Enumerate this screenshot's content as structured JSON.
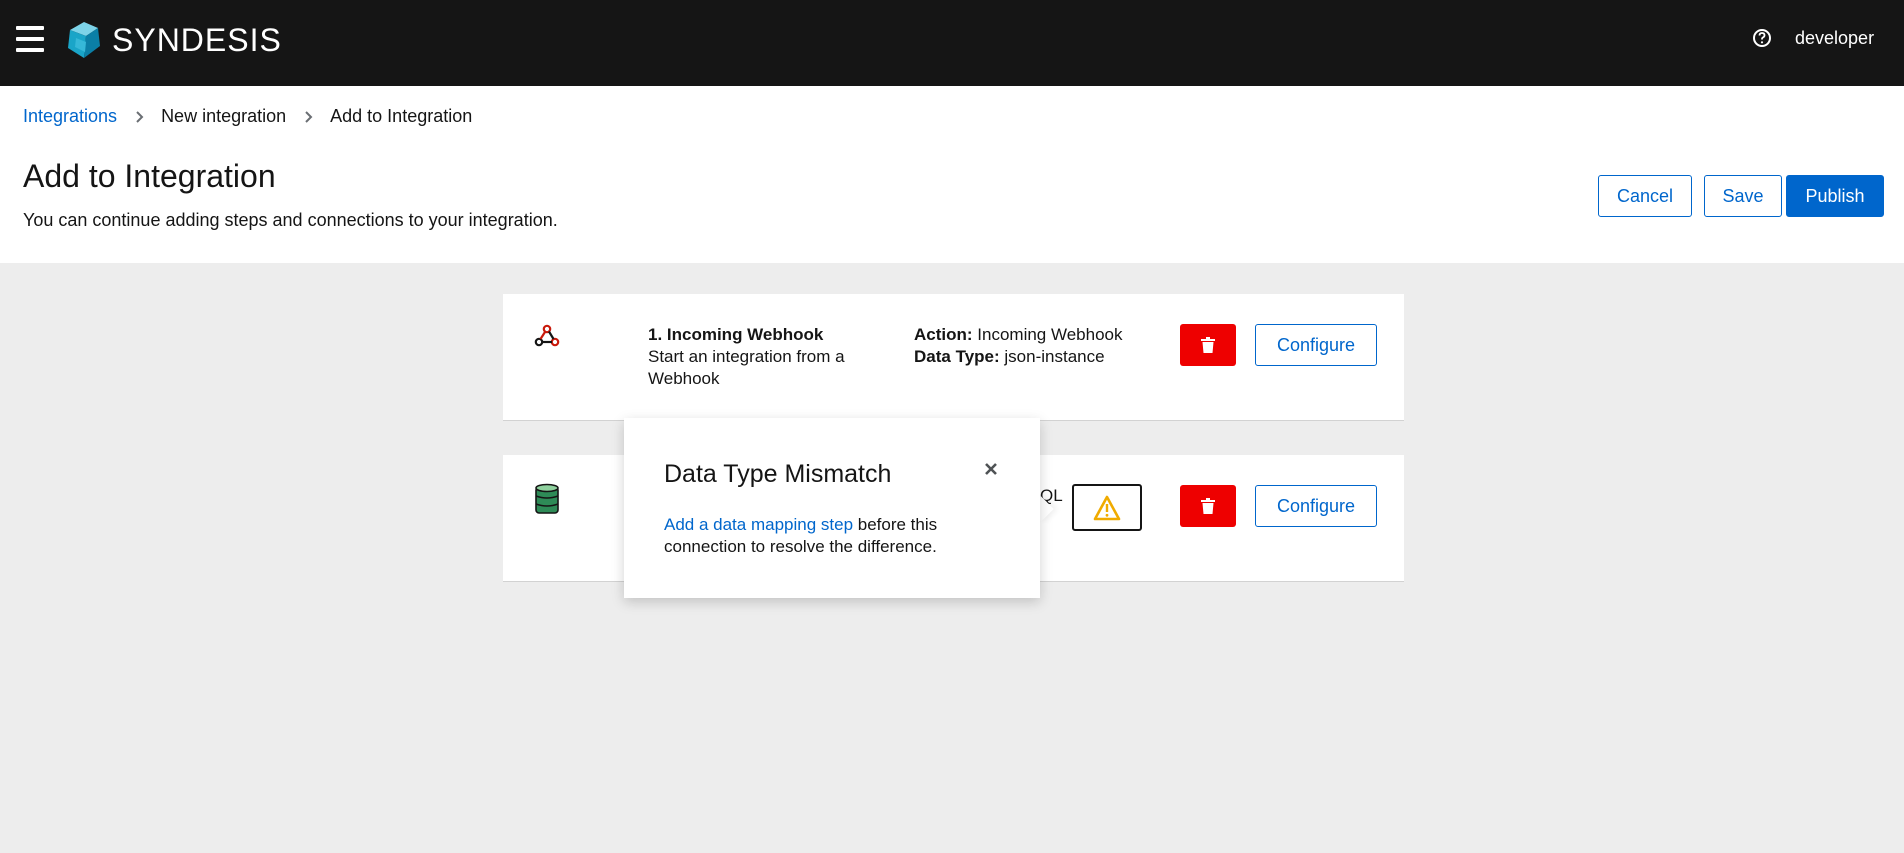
{
  "masthead": {
    "brand": "SYNDESIS",
    "username": "developer",
    "menu_icon": "hamburger-menu-icon",
    "help_icon": "help-circle-icon"
  },
  "breadcrumb": {
    "items": [
      "Integrations",
      "New integration",
      "Add to Integration"
    ]
  },
  "header": {
    "title": "Add to Integration",
    "description": "You can continue adding steps and connections to your integration."
  },
  "actions": {
    "cancel": "Cancel",
    "save": "Save",
    "publish": "Publish"
  },
  "steps": [
    {
      "icon": "webhook-icon",
      "title": "1. Incoming Webhook",
      "subtitle": "Start an integration from a Webhook",
      "action_label": "Action:",
      "action_value": "Incoming Webhook",
      "datatype_label": "Data Type:",
      "datatype_value": "json-instance",
      "configure": "Configure"
    },
    {
      "icon": "database-icon",
      "meta_fragment": "QL",
      "warning_icon": "warning-triangle-icon",
      "configure": "Configure"
    }
  ],
  "popover": {
    "title": "Data Type Mismatch",
    "link_text": "Add a data mapping step",
    "body_text": " before this connection to resolve the difference."
  },
  "colors": {
    "masthead": "#151515",
    "primary": "#0066cc",
    "danger": "#ee0000",
    "warning": "#f0ab00",
    "background": "#ededed"
  }
}
